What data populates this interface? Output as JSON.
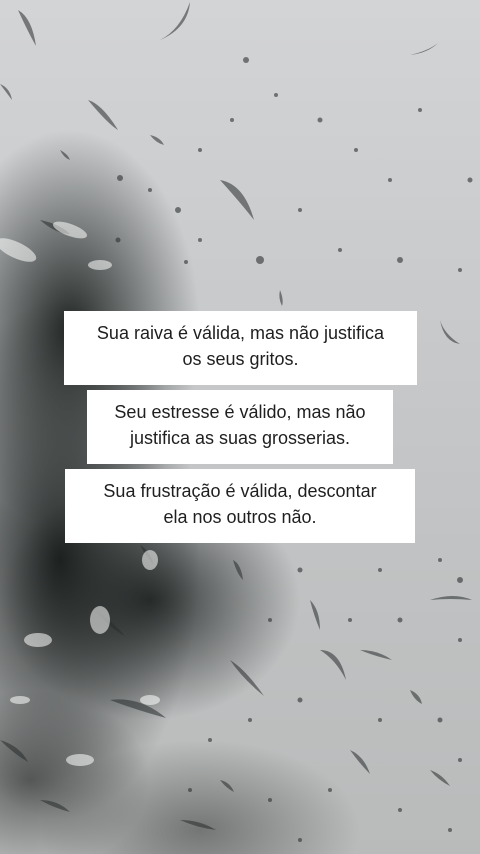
{
  "story": {
    "captions": [
      {
        "lines": [
          "Sua raiva é válida, mas não justifica",
          "os seus gritos."
        ]
      },
      {
        "lines": [
          "Seu estresse é válido, mas não",
          "justifica as suas grosserias."
        ]
      },
      {
        "lines": [
          "Sua frustração é válida, descontar",
          "ela nos outros não."
        ]
      }
    ]
  },
  "colors": {
    "caption_background": "#ffffff",
    "caption_text": "#1f1f1f",
    "sky": "#c8cacc",
    "foliage": "#1a1e1d"
  }
}
